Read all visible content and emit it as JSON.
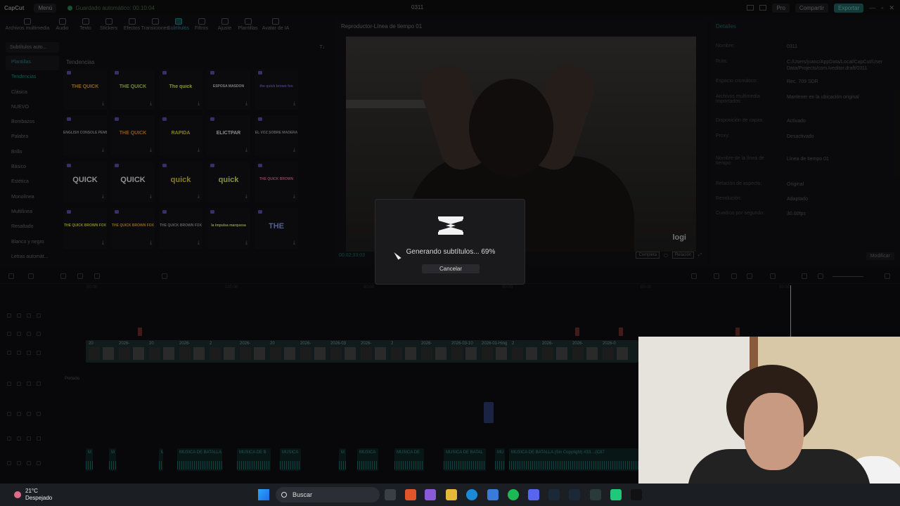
{
  "titlebar": {
    "app_name": "CapCut",
    "menu_label": "Menú",
    "autosave": "Guardado automático: 00:10:04",
    "doc_title": "0311",
    "pro_label": "Pro",
    "share_label": "Compartir",
    "export_label": "Exportar"
  },
  "tooltabs": [
    {
      "label": "Archivos multimedia",
      "active": false
    },
    {
      "label": "Audio",
      "active": false
    },
    {
      "label": "Texto",
      "active": false
    },
    {
      "label": "Stickers",
      "active": false
    },
    {
      "label": "Efectos",
      "active": false
    },
    {
      "label": "Transiciones",
      "active": false
    },
    {
      "label": "Subtítulos",
      "active": true
    },
    {
      "label": "Filtros",
      "active": false
    },
    {
      "label": "Ajuste",
      "active": false
    },
    {
      "label": "Plantillas",
      "active": false
    },
    {
      "label": "Avatar de IA",
      "active": false
    }
  ],
  "sidebar": {
    "header": "Subtítulos auto...",
    "items": [
      "Plantillas",
      "Tendencias",
      "Clásica",
      "NUEVO",
      "Bombazos",
      "Palabra",
      "Brillo",
      "Básico",
      "Estética",
      "Monolínea",
      "Multilínea",
      "Resaltado",
      "Blanco y negro",
      "Letras automát..."
    ]
  },
  "grid": {
    "section_title": "Tendencias",
    "tiles": [
      {
        "text": "THE QUICK",
        "color": "#e0a23a"
      },
      {
        "text": "THE QUICK",
        "color": "#b8d96a"
      },
      {
        "text": "The quick",
        "color": "#d8e85a"
      },
      {
        "text": "ESPOSA MASDON",
        "color": "#cccccc"
      },
      {
        "text": "the quick brown fox",
        "color": "#7a5ad8"
      },
      {
        "text": "ENGLISH CONSOLE PEMBROOK",
        "color": "#999999"
      },
      {
        "text": "THE QUICK",
        "color": "#e08a3a"
      },
      {
        "text": "RÁPIDA",
        "color": "#d8c83a"
      },
      {
        "text": "ELICTPAR",
        "color": "#dddddd"
      },
      {
        "text": "EL VOZ SOBRE MADERA",
        "color": "#999999"
      },
      {
        "text": "QUICK",
        "color": "#e6e6e6"
      },
      {
        "text": "QUICK",
        "color": "#e6e6e6"
      },
      {
        "text": "quick",
        "color": "#d8c83a"
      },
      {
        "text": "quick",
        "color": "#d8e86a"
      },
      {
        "text": "THE QUICK BROWN",
        "color": "#d86a8a"
      },
      {
        "text": "THE QUICK BROWN FOX",
        "color": "#d8d83a"
      },
      {
        "text": "THE QUICK BROWN FOX",
        "color": "#e0a23a"
      },
      {
        "text": "THE QUICK BROWN FOX",
        "color": "#999999"
      },
      {
        "text": "la impulsa marquesa",
        "color": "#d8e86a"
      },
      {
        "text": "THE",
        "color": "#8a9ae6"
      }
    ],
    "sort_label": "T↓"
  },
  "player": {
    "title": "Reproductor-Línea de tiempo 01",
    "timecode": "00:02:33:03",
    "watermark": "logi",
    "ctrl_full": "Completa",
    "ctrl_ratio": "Relación"
  },
  "details": {
    "title": "Detalles",
    "rows": [
      {
        "key": "Nombre:",
        "value": "0311"
      },
      {
        "key": "Ruta:",
        "value": "C:/Users/juanc/AppData/Local/CapCut/User Data/Projects/com.lveditor.draft/0311"
      },
      {
        "key": "Espacio cromático:",
        "value": "Rec. 709 SDR"
      },
      {
        "key": "Archivos multimedia importados:",
        "value": "Mantener en la ubicación original"
      },
      {
        "key": "Disposición de capas:",
        "value": "Activado"
      },
      {
        "key": "Proxy:",
        "value": "Desactivado"
      },
      {
        "key": "Nombre de la línea de tiempo:",
        "value": "Línea de tiempo 01"
      },
      {
        "key": "Relación de aspecto:",
        "value": "Original"
      },
      {
        "key": "Resolución:",
        "value": "Adaptado"
      },
      {
        "key": "Cuadros por segundo:",
        "value": "30.00fps"
      }
    ],
    "modify_label": "Modificar"
  },
  "timeline": {
    "ruler": [
      "00:00",
      "100:00",
      "00:00",
      "00:00",
      "00:00",
      "00:00"
    ],
    "video_labels": [
      "20",
      "2026-",
      "20",
      "2026-",
      "2",
      "2026-",
      "20",
      "2026-",
      "2026-03",
      "2026-",
      "2",
      "2026-",
      "2026-03-10",
      "2026-01-Hing",
      "2",
      "2026-",
      "2026-",
      "2026-0"
    ],
    "cover_label": "Portada",
    "audio_clips": [
      {
        "label": "M"
      },
      {
        "label": "M"
      },
      {
        "label": "M"
      },
      {
        "label": "MUSICA DE BATALLA"
      },
      {
        "label": "MUSICA DE B"
      },
      {
        "label": "MUSICA"
      },
      {
        "label": "M"
      },
      {
        "label": "MUSICA"
      },
      {
        "label": "MUSICA DE"
      },
      {
        "label": "MUSICA DE BATAL"
      },
      {
        "label": "MU"
      },
      {
        "label": "MUSICA DE BATALLA (Sin Copyright) #33...-[C87"
      }
    ]
  },
  "dialog": {
    "progress_text": "Generando subtítulos... 69%",
    "progress_percent": 69,
    "cancel_label": "Cancelar"
  },
  "taskbar": {
    "temperature": "21°C",
    "condition": "Despejado",
    "search_label": "Buscar"
  }
}
